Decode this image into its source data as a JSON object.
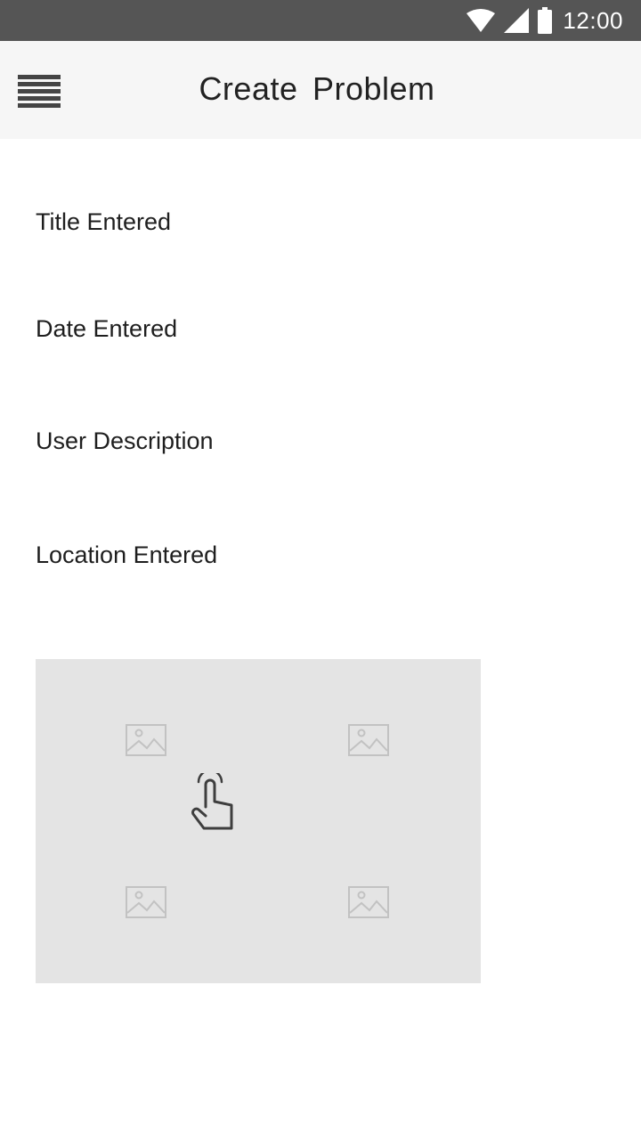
{
  "status_bar": {
    "time": "12:00",
    "icons": [
      "wifi-icon",
      "signal-icon",
      "battery-icon"
    ],
    "background": "#555555"
  },
  "app_bar": {
    "title": "Create  Problem",
    "menu_icon": "hamburger-menu-icon",
    "background": "#f6f6f6"
  },
  "form": {
    "title_field": "Title Entered",
    "date_field": "Date Entered",
    "description_field": "User Description",
    "location_field": "Location Entered"
  },
  "image_gallery": {
    "background": "#e4e4e4",
    "placeholders": [
      "image-placeholder-icon",
      "image-placeholder-icon",
      "image-placeholder-icon",
      "image-placeholder-icon"
    ],
    "gesture_icon": "tap-hand-icon"
  }
}
